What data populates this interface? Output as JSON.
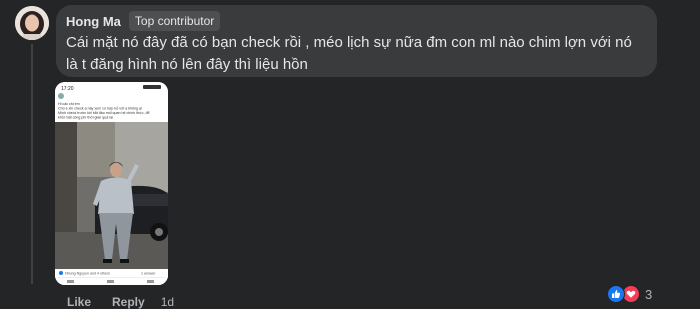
{
  "comment": {
    "author": "Hong Ma",
    "badge": "Top contributor",
    "text": "Cái mặt nó đây đã có bạn check rồi , méo lịch sự nữa đm con ml nào chim lợn với nó là t đăng hình nó lên đây thì liệu hồn",
    "actions": {
      "like": "Like",
      "reply": "Reply",
      "time": "1d"
    },
    "reactions": {
      "types": [
        "like",
        "love"
      ],
      "count": "3"
    }
  },
  "attachment": {
    "status_time": "17:20",
    "post_lines": [
      "Hi các chị em",
      "Cho e xin check ạ này xem có hợp hỏ với a không ạ!",
      "Mình check trước khi bắt đầu mối quan hệ chính thức, để",
      "khỏi mất công phí thời gian quá lại"
    ],
    "footer_name": "Nhung Nguyen and 4 others",
    "footer_count": "1 answer"
  },
  "colors": {
    "page_bg": "#242526",
    "bubble_bg": "#3a3b3c",
    "badge_bg": "#4e4f50",
    "text_primary": "#e4e6eb",
    "text_secondary": "#b0b3b8",
    "like_blue": "#1877f2",
    "love_red": "#f33e58"
  }
}
